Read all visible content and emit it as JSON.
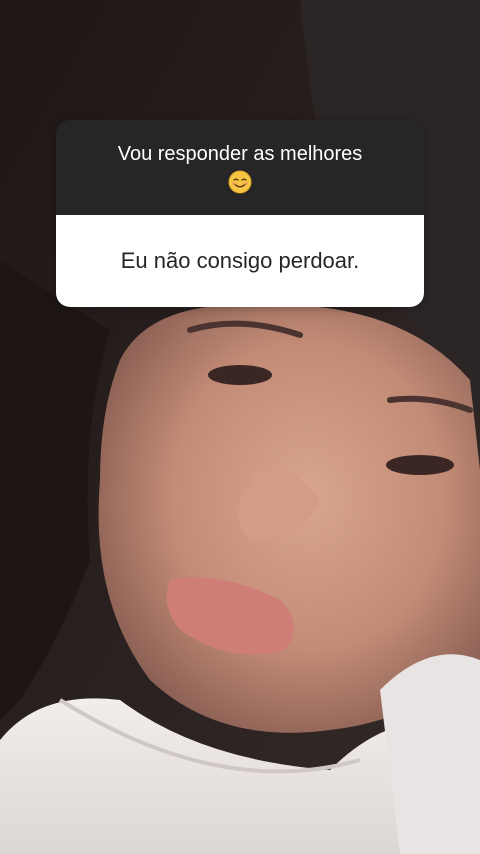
{
  "question_sticker": {
    "prompt": "Vou responder as melhores",
    "emoji_icon": "smiling-face-emoji-icon",
    "answer": "Eu não consigo perdoar."
  },
  "colors": {
    "sticker_header_bg": "#262626",
    "sticker_answer_bg": "#ffffff",
    "sticker_text_light": "#ffffff",
    "sticker_text_dark": "#262626"
  }
}
